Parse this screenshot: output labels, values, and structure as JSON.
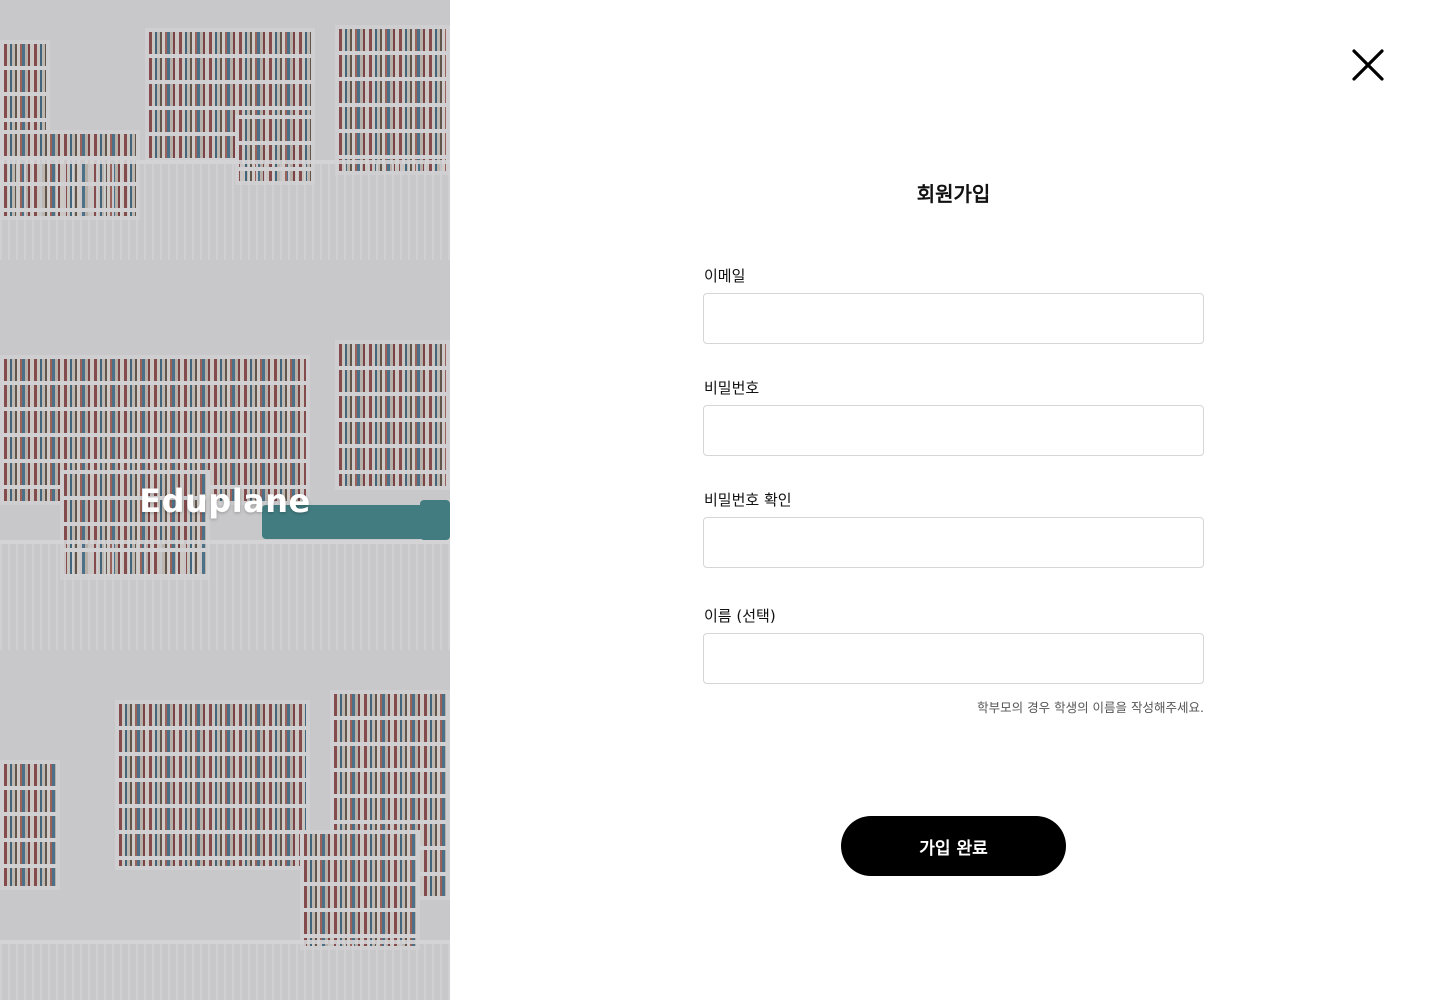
{
  "brand": {
    "name": "Eduplane"
  },
  "close_button": {
    "icon": "close-icon"
  },
  "signup": {
    "title": "회원가입",
    "fields": [
      {
        "label": "이메일",
        "value": "",
        "placeholder": ""
      },
      {
        "label": "비밀번호",
        "value": "",
        "placeholder": ""
      },
      {
        "label": "비밀번호 확인",
        "value": "",
        "placeholder": ""
      },
      {
        "label": "이름 (선택)",
        "value": "",
        "placeholder": ""
      }
    ],
    "name_hint": "학부모의 경우 학생의 이름을 작성해주세요.",
    "submit_label": "가입 완료"
  },
  "colors": {
    "primary_button": "#000000",
    "input_border": "#d6d6d6",
    "hero_overlay": "#78787d",
    "brand_text": "#ffffff"
  }
}
